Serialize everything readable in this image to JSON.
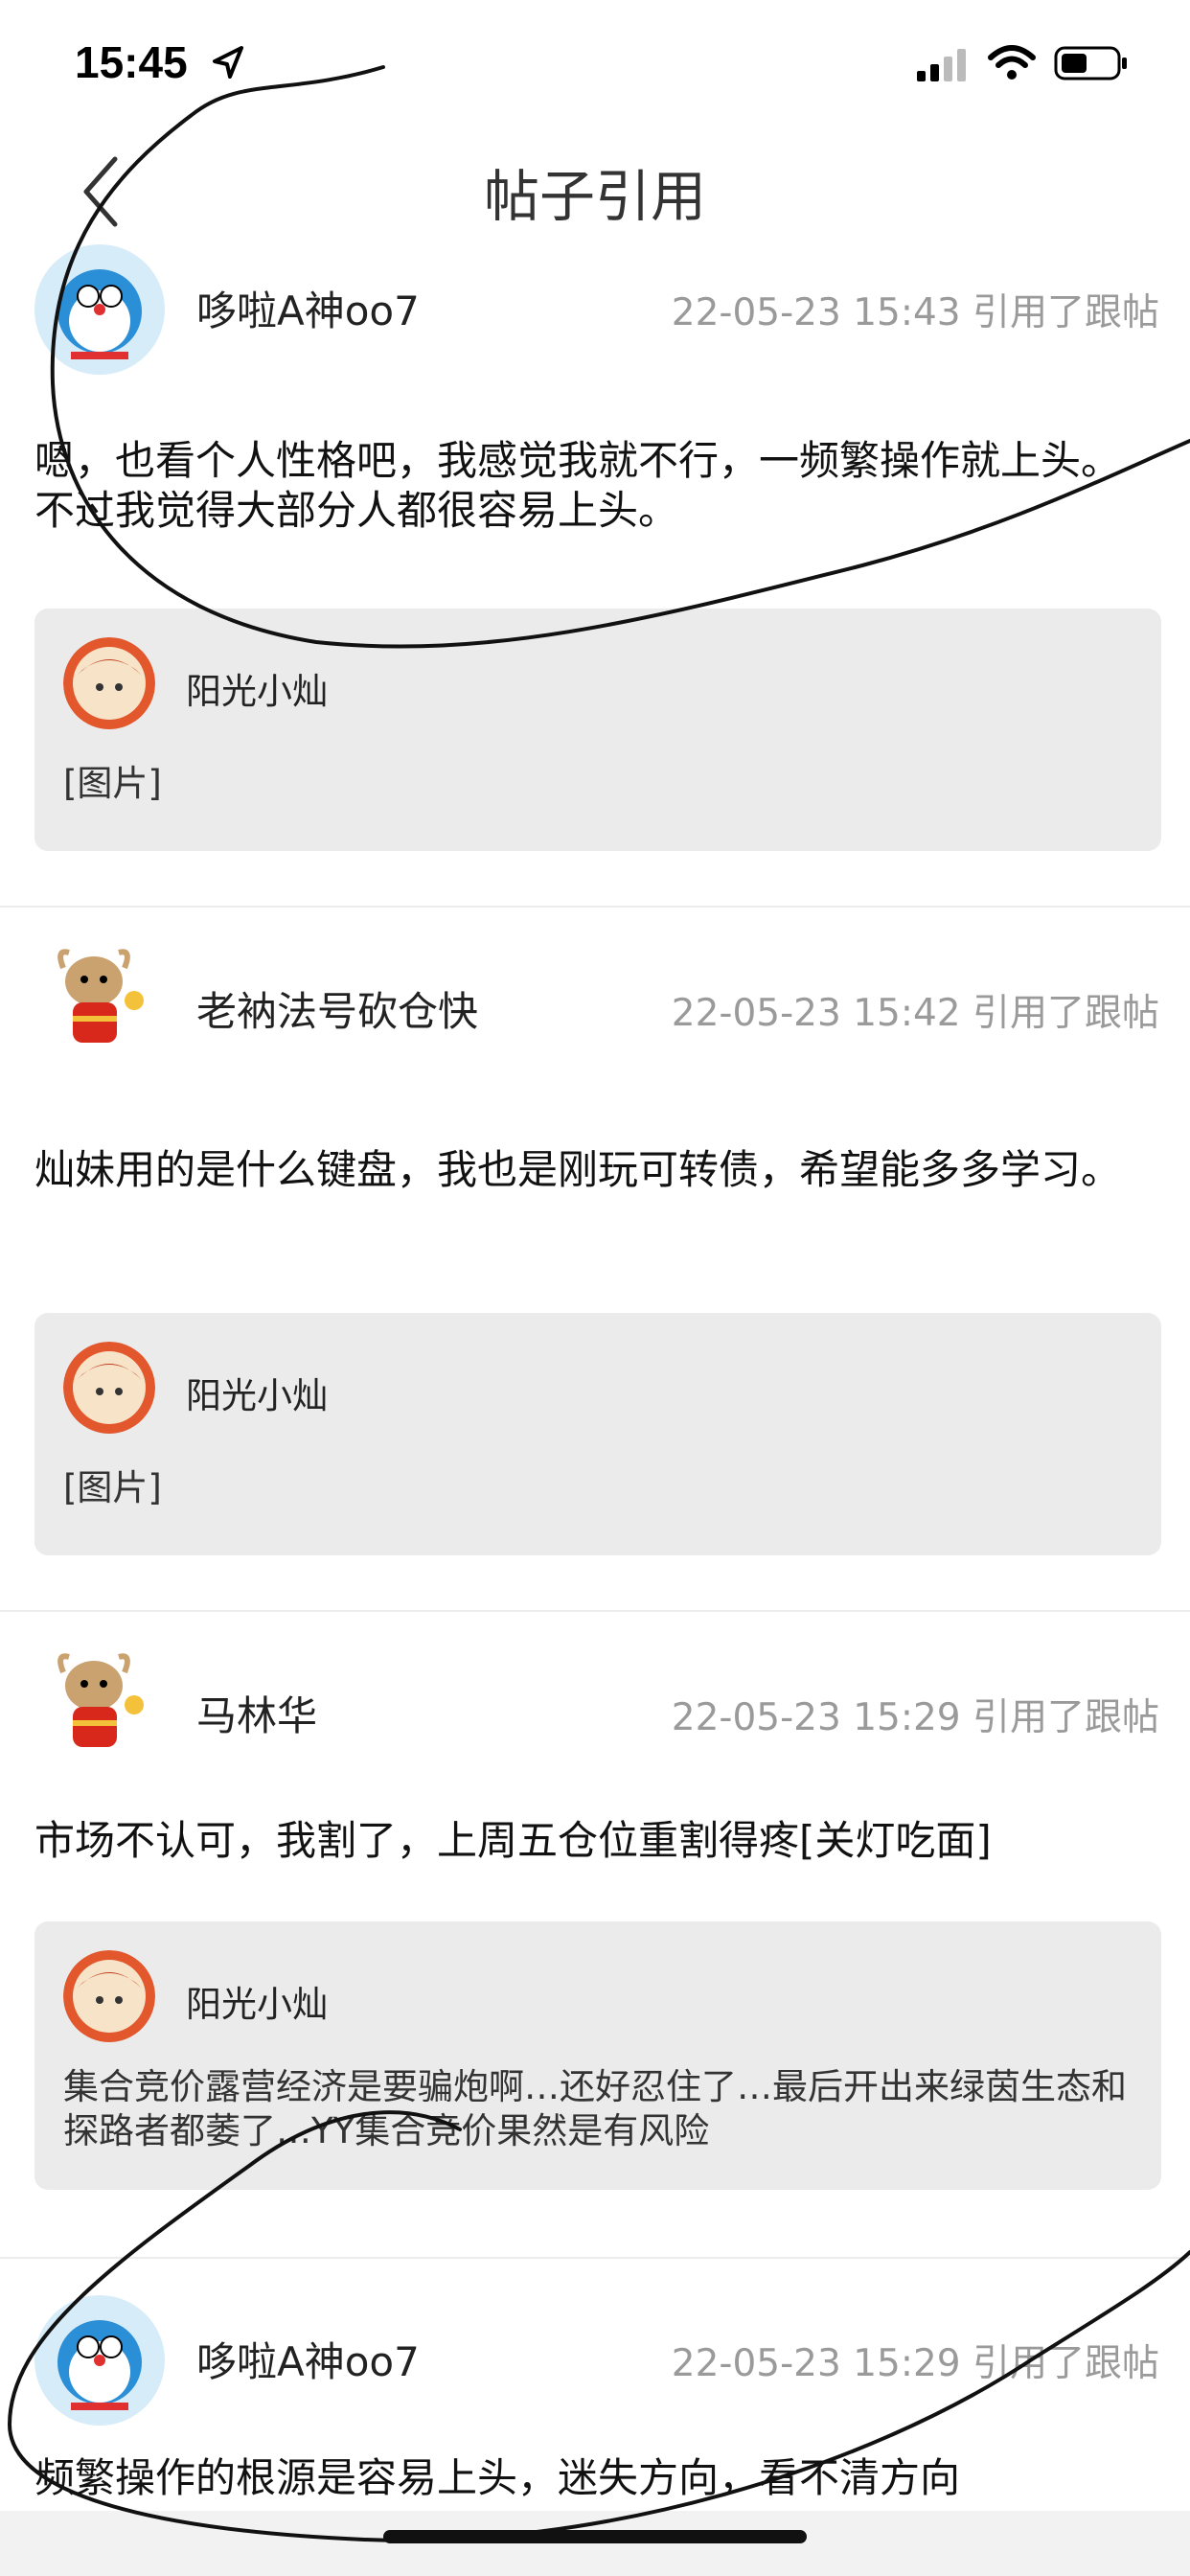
{
  "status_bar": {
    "time": "15:45"
  },
  "nav": {
    "title": "帖子引用"
  },
  "posts": [
    {
      "user": "哆啦A神oo7",
      "meta": "22-05-23 15:43 引用了跟帖",
      "content": "嗯，也看个人性格吧，我感觉我就不行，一频繁操作就上头。不过我觉得大部分人都很容易上头。",
      "quote": {
        "user": "阳光小灿",
        "text": "[图片]"
      }
    },
    {
      "user": "老衲法号砍仓快",
      "meta": "22-05-23 15:42 引用了跟帖",
      "content": "灿妹用的是什么键盘，我也是刚玩可转债，希望能多多学习。",
      "quote": {
        "user": "阳光小灿",
        "text": "[图片]"
      }
    },
    {
      "user": "马林华",
      "meta": "22-05-23 15:29 引用了跟帖",
      "content": "市场不认可，我割了，上周五仓位重割得疼[关灯吃面]",
      "quote": {
        "user": "阳光小灿",
        "text": "集合竞价露营经济是要骗炮啊…还好忍住了…最后开出来绿茵生态和探路者都萎了…YY集合竞价果然是有风险"
      }
    },
    {
      "user": "哆啦A神oo7",
      "meta": "22-05-23 15:29 引用了跟帖",
      "content": "频繁操作的根源是容易上头，迷失方向，看不清方向"
    }
  ],
  "icons": {
    "location": "location-arrow-icon",
    "signal": "cellular-signal-icon",
    "wifi": "wifi-icon",
    "battery": "battery-icon",
    "back": "chevron-left-icon"
  },
  "colors": {
    "quote_bg": "#ebebeb",
    "meta": "#9a9a9a"
  }
}
